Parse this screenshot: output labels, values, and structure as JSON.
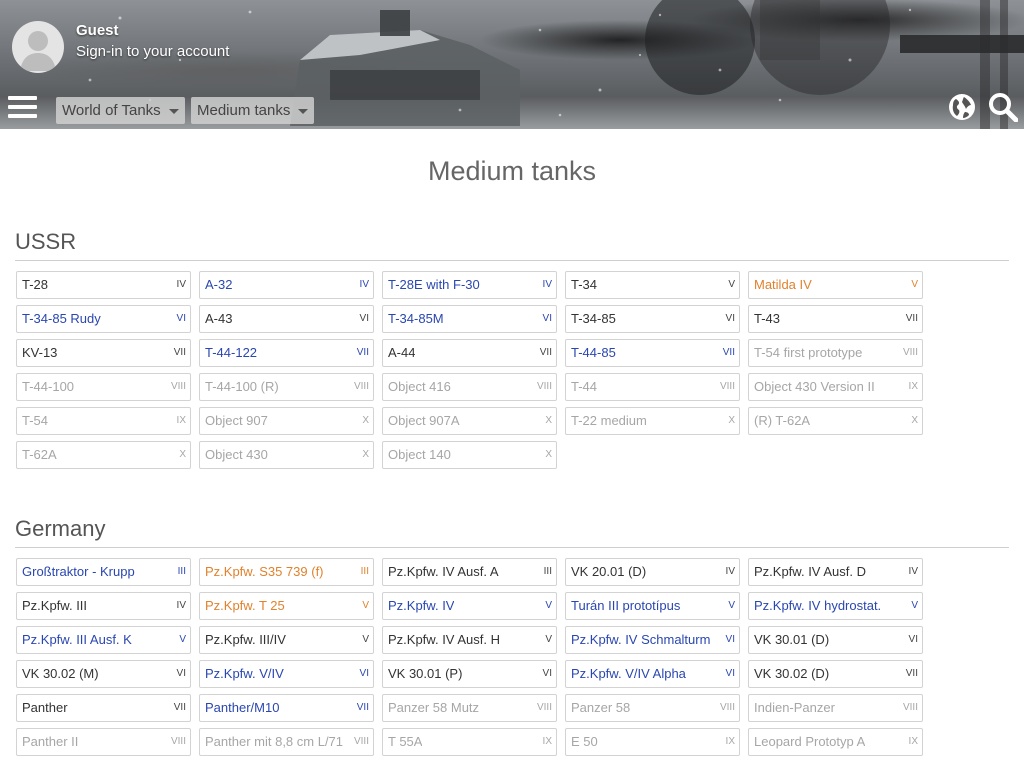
{
  "header": {
    "user_name": "Guest",
    "signin_label": "Sign-in to your account",
    "breadcrumbs": [
      {
        "label": "World of Tanks"
      },
      {
        "label": "Medium tanks"
      }
    ],
    "icons": {
      "menu": "hamburger-menu-icon",
      "language": "globe-icon",
      "search": "search-icon",
      "avatar": "user-avatar-icon"
    }
  },
  "page": {
    "title": "Medium tanks"
  },
  "colors": {
    "standard": "#333333",
    "premium": "#2a47b0",
    "gift": "#e0822e",
    "unavailable": "#a6a6a6"
  },
  "sections": [
    {
      "title": "USSR",
      "tanks": [
        {
          "name": "T-28",
          "tier": "IV",
          "type": "std"
        },
        {
          "name": "A-32",
          "tier": "IV",
          "type": "prem"
        },
        {
          "name": "T-28E with F-30",
          "tier": "IV",
          "type": "prem"
        },
        {
          "name": "T-34",
          "tier": "V",
          "type": "std"
        },
        {
          "name": "Matilda IV",
          "tier": "V",
          "type": "gift"
        },
        {
          "name": "T-34-85 Rudy",
          "tier": "VI",
          "type": "prem"
        },
        {
          "name": "A-43",
          "tier": "VI",
          "type": "std"
        },
        {
          "name": "T-34-85M",
          "tier": "VI",
          "type": "prem"
        },
        {
          "name": "T-34-85",
          "tier": "VI",
          "type": "std"
        },
        {
          "name": "T-43",
          "tier": "VII",
          "type": "std"
        },
        {
          "name": "KV-13",
          "tier": "VII",
          "type": "std"
        },
        {
          "name": "T-44-122",
          "tier": "VII",
          "type": "prem"
        },
        {
          "name": "A-44",
          "tier": "VII",
          "type": "std"
        },
        {
          "name": "T-44-85",
          "tier": "VII",
          "type": "prem"
        },
        {
          "name": "T-54 first prototype",
          "tier": "VIII",
          "type": "grey"
        },
        {
          "name": "T-44-100",
          "tier": "VIII",
          "type": "grey"
        },
        {
          "name": "T-44-100 (R)",
          "tier": "VIII",
          "type": "grey"
        },
        {
          "name": "Object 416",
          "tier": "VIII",
          "type": "grey"
        },
        {
          "name": "T-44",
          "tier": "VIII",
          "type": "grey"
        },
        {
          "name": "Object 430 Version II",
          "tier": "IX",
          "type": "grey"
        },
        {
          "name": "T-54",
          "tier": "IX",
          "type": "grey"
        },
        {
          "name": "Object 907",
          "tier": "X",
          "type": "grey"
        },
        {
          "name": "Object 907A",
          "tier": "X",
          "type": "grey"
        },
        {
          "name": "T-22 medium",
          "tier": "X",
          "type": "grey"
        },
        {
          "name": "(R) T-62A",
          "tier": "X",
          "type": "grey"
        },
        {
          "name": "T-62A",
          "tier": "X",
          "type": "grey"
        },
        {
          "name": "Object 430",
          "tier": "X",
          "type": "grey"
        },
        {
          "name": "Object 140",
          "tier": "X",
          "type": "grey"
        }
      ]
    },
    {
      "title": "Germany",
      "tanks": [
        {
          "name": "Großtraktor - Krupp",
          "tier": "III",
          "type": "prem"
        },
        {
          "name": "Pz.Kpfw. S35 739 (f)",
          "tier": "III",
          "type": "gift"
        },
        {
          "name": "Pz.Kpfw. IV Ausf. A",
          "tier": "III",
          "type": "std"
        },
        {
          "name": "VK 20.01 (D)",
          "tier": "IV",
          "type": "std"
        },
        {
          "name": "Pz.Kpfw. IV Ausf. D",
          "tier": "IV",
          "type": "std"
        },
        {
          "name": "Pz.Kpfw. III",
          "tier": "IV",
          "type": "std"
        },
        {
          "name": "Pz.Kpfw. T 25",
          "tier": "V",
          "type": "gift"
        },
        {
          "name": "Pz.Kpfw. IV",
          "tier": "V",
          "type": "prem"
        },
        {
          "name": "Turán III prototípus",
          "tier": "V",
          "type": "prem"
        },
        {
          "name": "Pz.Kpfw. IV hydrostat.",
          "tier": "V",
          "type": "prem"
        },
        {
          "name": "Pz.Kpfw. III Ausf. K",
          "tier": "V",
          "type": "prem"
        },
        {
          "name": "Pz.Kpfw. III/IV",
          "tier": "V",
          "type": "std"
        },
        {
          "name": "Pz.Kpfw. IV Ausf. H",
          "tier": "V",
          "type": "std"
        },
        {
          "name": "Pz.Kpfw. IV Schmalturm",
          "tier": "VI",
          "type": "prem"
        },
        {
          "name": "VK 30.01 (D)",
          "tier": "VI",
          "type": "std"
        },
        {
          "name": "VK 30.02 (M)",
          "tier": "VI",
          "type": "std"
        },
        {
          "name": "Pz.Kpfw. V/IV",
          "tier": "VI",
          "type": "prem"
        },
        {
          "name": "VK 30.01 (P)",
          "tier": "VI",
          "type": "std"
        },
        {
          "name": "Pz.Kpfw. V/IV Alpha",
          "tier": "VI",
          "type": "prem"
        },
        {
          "name": "VK 30.02 (D)",
          "tier": "VII",
          "type": "std"
        },
        {
          "name": "Panther",
          "tier": "VII",
          "type": "std"
        },
        {
          "name": "Panther/M10",
          "tier": "VII",
          "type": "prem"
        },
        {
          "name": "Panzer 58 Mutz",
          "tier": "VIII",
          "type": "grey"
        },
        {
          "name": "Panzer 58",
          "tier": "VIII",
          "type": "grey"
        },
        {
          "name": "Indien-Panzer",
          "tier": "VIII",
          "type": "grey"
        },
        {
          "name": "Panther II",
          "tier": "VIII",
          "type": "grey"
        },
        {
          "name": "Panther mit 8,8 cm L/71",
          "tier": "VIII",
          "type": "grey"
        },
        {
          "name": "T 55A",
          "tier": "IX",
          "type": "grey"
        },
        {
          "name": "E 50",
          "tier": "IX",
          "type": "grey"
        },
        {
          "name": "Leopard Prototyp A",
          "tier": "IX",
          "type": "grey"
        }
      ]
    }
  ]
}
